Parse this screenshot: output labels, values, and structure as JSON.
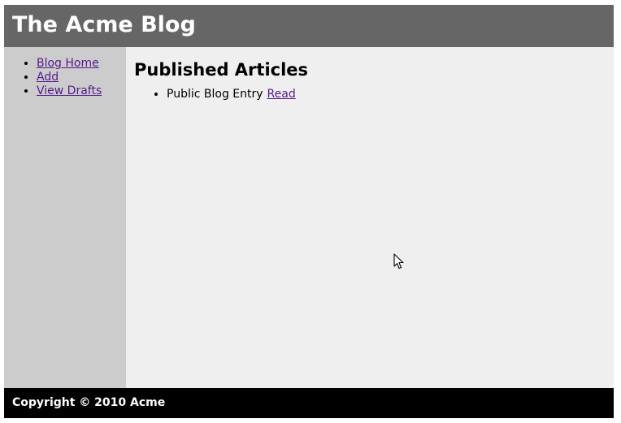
{
  "header": {
    "title": "The Acme Blog"
  },
  "sidebar": {
    "items": [
      {
        "label": "Blog Home"
      },
      {
        "label": "Add"
      },
      {
        "label": "View Drafts"
      }
    ]
  },
  "main": {
    "heading": "Published Articles",
    "articles": [
      {
        "title": "Public Blog Entry",
        "link_label": "Read"
      }
    ]
  },
  "footer": {
    "text": "Copyright © 2010 Acme"
  },
  "colors": {
    "header_bg": "#666666",
    "sidebar_bg": "#cccccc",
    "content_bg": "#efefef",
    "footer_bg": "#000000",
    "link": "#551a8b"
  },
  "icons": {
    "cursor": "mouse-pointer-icon"
  }
}
